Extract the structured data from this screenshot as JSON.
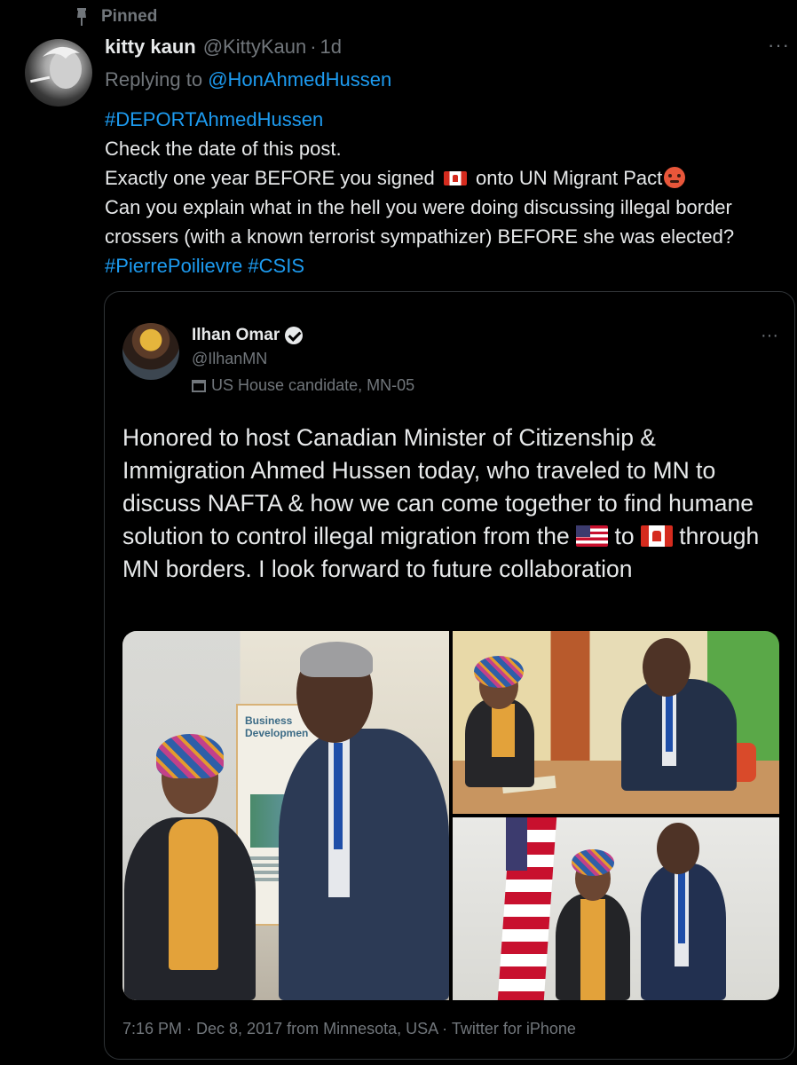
{
  "pinned": {
    "label": "Pinned"
  },
  "tweet": {
    "display_name": "kitty kaun",
    "handle": "@KittyKaun",
    "separator": "·",
    "time": "1d",
    "reply_prefix": "Replying to ",
    "reply_to": "@HonAhmedHussen",
    "hashtag_deport": "#DEPORTAhmedHussen",
    "line1": "Check the date of this post.",
    "line2_a": "Exactly one year BEFORE you signed ",
    "line2_b": " onto UN Migrant Pact",
    "line3": "Can you explain what in the hell you were doing discussing illegal border crossers (with a known terrorist sympathizer) BEFORE she was elected? ",
    "hashtag_pierre": "#PierrePoilievre",
    "hashtag_csis": "#CSIS",
    "more": "···"
  },
  "quoted": {
    "display_name": "Ilhan Omar",
    "handle": "@IlhanMN",
    "label": "US House candidate, MN-05",
    "more": "···",
    "text_a": "Honored to host Canadian Minister of Citizenship & Immigration Ahmed Hussen today, who traveled to MN to discuss NAFTA & how we can come together to find humane solution to control illegal migration from the ",
    "text_b": " to ",
    "text_c": " through MN borders. I look forward to future collaboration",
    "sign_text": "Business Developmen",
    "footer": "7:16 PM · Dec 8, 2017 from Minnesota, USA · Twitter for iPhone"
  },
  "icons": [
    "pin-icon",
    "more-icon",
    "canada-flag-icon",
    "angry-face-icon",
    "verified-badge-icon",
    "ballot-box-icon",
    "us-flag-icon"
  ],
  "colors": {
    "background": "#000000",
    "text": "#e7e9ea",
    "muted": "#71767b",
    "link": "#1d9bf0",
    "border": "#2f3336"
  }
}
